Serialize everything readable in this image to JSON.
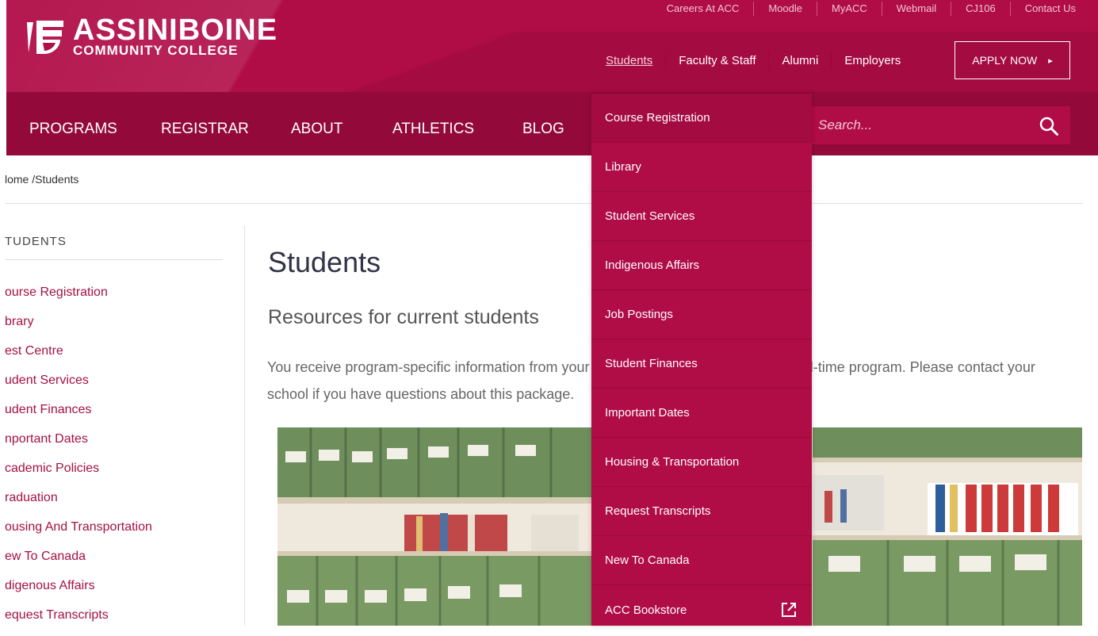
{
  "logo": {
    "title": "ASSINIBOINE",
    "subtitle": "COMMUNITY COLLEGE"
  },
  "utility_nav": [
    "Careers At ACC",
    "Moodle",
    "MyACC",
    "Webmail",
    "CJ106",
    "Contact Us"
  ],
  "audience_nav": {
    "items": [
      "Students",
      "Faculty & Staff",
      "Alumni",
      "Employers"
    ],
    "active": "Students"
  },
  "apply_button": {
    "label": "APPLY NOW",
    "arrow": "▸"
  },
  "main_nav": [
    "PROGRAMS",
    "REGISTRAR",
    "ABOUT",
    "ATHLETICS",
    "BLOG"
  ],
  "search": {
    "placeholder": "Search..."
  },
  "breadcrumb": "lome /Students",
  "sidebar": {
    "title": "TUDENTS",
    "items": [
      "ourse Registration",
      "brary",
      "est Centre",
      "udent Services",
      "udent Finances",
      "nportant Dates",
      "cademic Policies",
      "raduation",
      "ousing And Transportation",
      "ew To Canada",
      "digenous Affairs",
      "equest Transcripts"
    ]
  },
  "main": {
    "title": "Students",
    "subtitle": "Resources for current students",
    "paragraph": "You receive program-specific information from your school's office when you start a full-time program. Please contact your school if you have questions about this package."
  },
  "dropdown": {
    "items": [
      "Course Registration",
      "Library",
      "Student Services",
      "Indigenous Affairs",
      "Job Postings",
      "Student Finances",
      "Important Dates",
      "Housing & Transportation",
      "Request Transcripts",
      "New To Canada",
      "ACC Bookstore"
    ],
    "external_icon": "external-link-icon"
  },
  "colors": {
    "brand": "#b00c45",
    "nav_dark": "#930a3a",
    "link": "#a51044"
  }
}
